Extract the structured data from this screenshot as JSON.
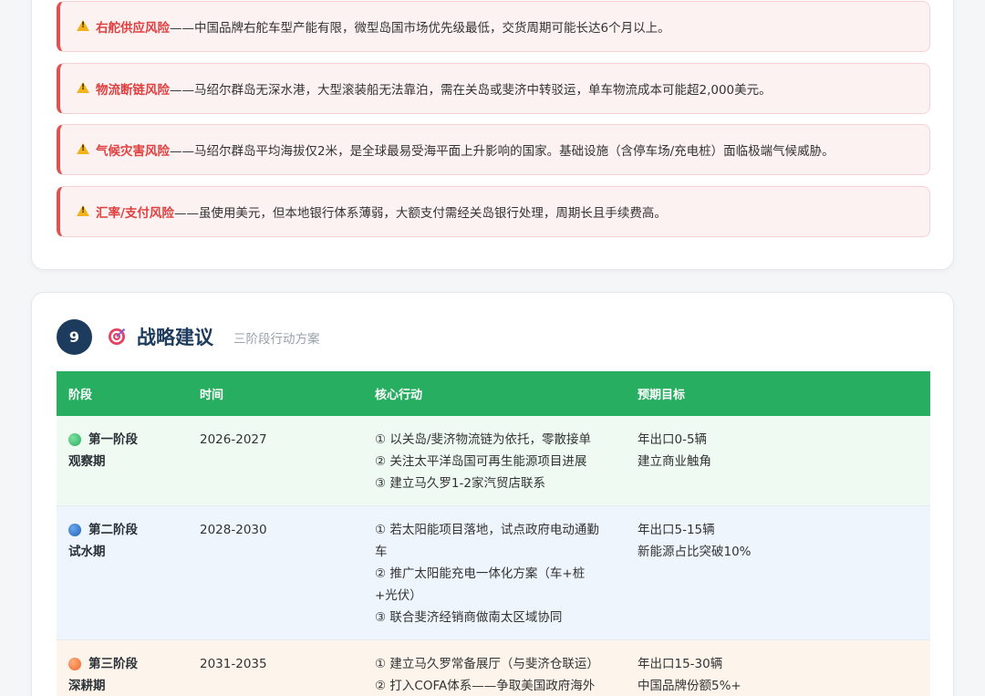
{
  "risks": [
    {
      "name": "右舵供应风险",
      "desc": "——中国品牌右舵车型产能有限，微型岛国市场优先级最低，交货周期可能长达6个月以上。"
    },
    {
      "name": "物流断链风险",
      "desc": "——马绍尔群岛无深水港，大型滚装船无法靠泊，需在关岛或斐济中转驳运，单车物流成本可能超2,000美元。"
    },
    {
      "name": "气候灾害风险",
      "desc": "——马绍尔群岛平均海拔仅2米，是全球最易受海平面上升影响的国家。基础设施（含停车场/充电桩）面临极端气候威胁。"
    },
    {
      "name": "汇率/支付风险",
      "desc": "——虽使用美元，但本地银行体系薄弱，大额支付需经关岛银行处理，周期长且手续费高。"
    }
  ],
  "section": {
    "number": "9",
    "icon": "target-icon",
    "title": "战略建议",
    "subtitle": "三阶段行动方案"
  },
  "table": {
    "headers": [
      "阶段",
      "时间",
      "核心行动",
      "预期目标"
    ],
    "header_color": "#27ae60",
    "rows": [
      {
        "phase": "第一阶段",
        "period": "观察期",
        "dot": "green",
        "time": "2026-2027",
        "actions": [
          "① 以关岛/斐济物流链为依托，零散接单",
          "② 关注太平洋岛国可再生能源项目进展",
          "③ 建立马久罗1-2家汽贸店联系"
        ],
        "goals": [
          "年出口0-5辆",
          "建立商业触角"
        ]
      },
      {
        "phase": "第二阶段",
        "period": "试水期",
        "dot": "blue",
        "time": "2028-2030",
        "actions": [
          "① 若太阳能项目落地，试点政府电动通勤",
          "车",
          "② 推广太阳能充电一体化方案（车+桩",
          "+光伏）",
          "③ 联合斐济经销商做南太区域协同"
        ],
        "goals": [
          "年出口5-15辆",
          "新能源占比突破10%"
        ]
      },
      {
        "phase": "第三阶段",
        "period": "深耕期",
        "dot": "orange",
        "time": "2031-2035",
        "actions": [
          "① 建立马久罗常备展厅（与斐济仓联运）",
          "② 打入COFA体系——争取美国政府海外"
        ],
        "goals": [
          "年出口15-30辆",
          "中国品牌份额5%+"
        ]
      }
    ]
  }
}
